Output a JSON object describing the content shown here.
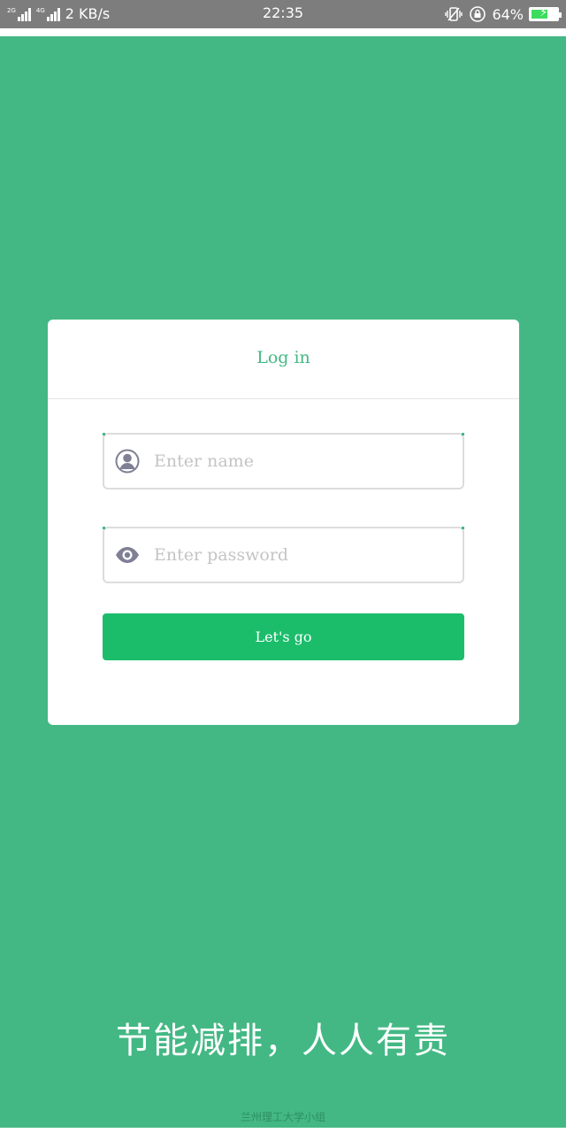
{
  "status_bar": {
    "network_1": "2G",
    "network_2": "4G",
    "speed": "2 KB/s",
    "time": "22:35",
    "battery_percent": "64%",
    "battery_level": 0.64,
    "icons": [
      "vibrate-icon",
      "rotation-lock-icon",
      "battery-icon"
    ]
  },
  "login": {
    "title": "Log in",
    "name_placeholder": "Enter name",
    "password_placeholder": "Enter password",
    "submit_label": "Let's go",
    "icons": {
      "name": "user-icon",
      "password": "eye-icon"
    }
  },
  "footer": {
    "slogan": "节能减排，人人有责",
    "credit": "兰州理工大学小组"
  },
  "colors": {
    "background": "#43b884",
    "card": "#ffffff",
    "button": "#1bbd6b",
    "status_bar": "#7d7d7d"
  }
}
